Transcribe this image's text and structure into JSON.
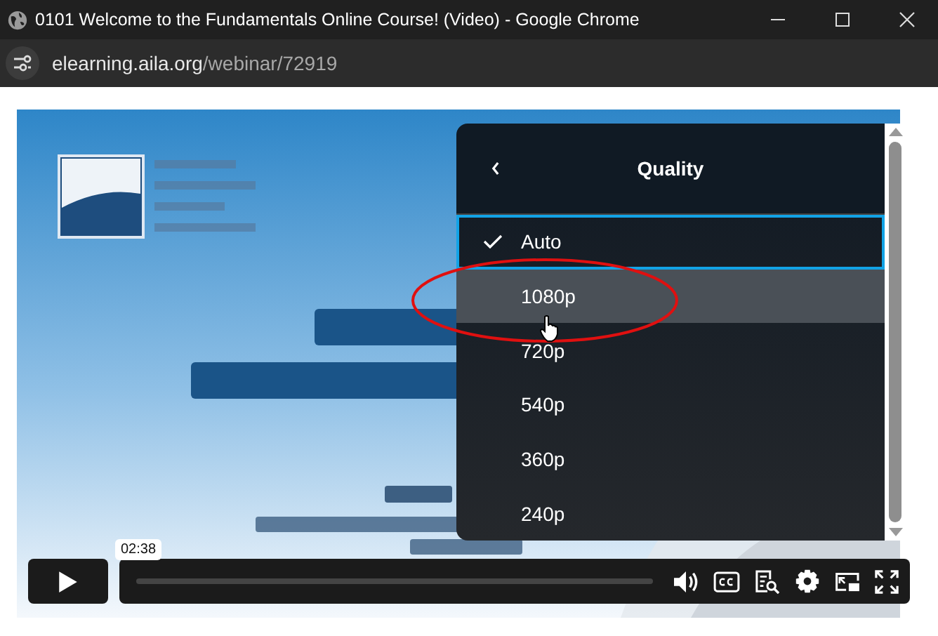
{
  "window": {
    "title": "0101 Welcome to the Fundamentals Online Course! (Video) - Google Chrome"
  },
  "address": {
    "domain": "elearning.aila.org",
    "path": "/webinar/72919"
  },
  "quality_menu": {
    "title": "Quality",
    "items": [
      {
        "label": "Auto",
        "selected": true,
        "hovered": false
      },
      {
        "label": "1080p",
        "selected": false,
        "hovered": true
      },
      {
        "label": "720p",
        "selected": false,
        "hovered": false
      },
      {
        "label": "540p",
        "selected": false,
        "hovered": false
      },
      {
        "label": "360p",
        "selected": false,
        "hovered": false
      },
      {
        "label": "240p",
        "selected": false,
        "hovered": false
      }
    ]
  },
  "player": {
    "time_tooltip": "02:38",
    "playing": false
  }
}
